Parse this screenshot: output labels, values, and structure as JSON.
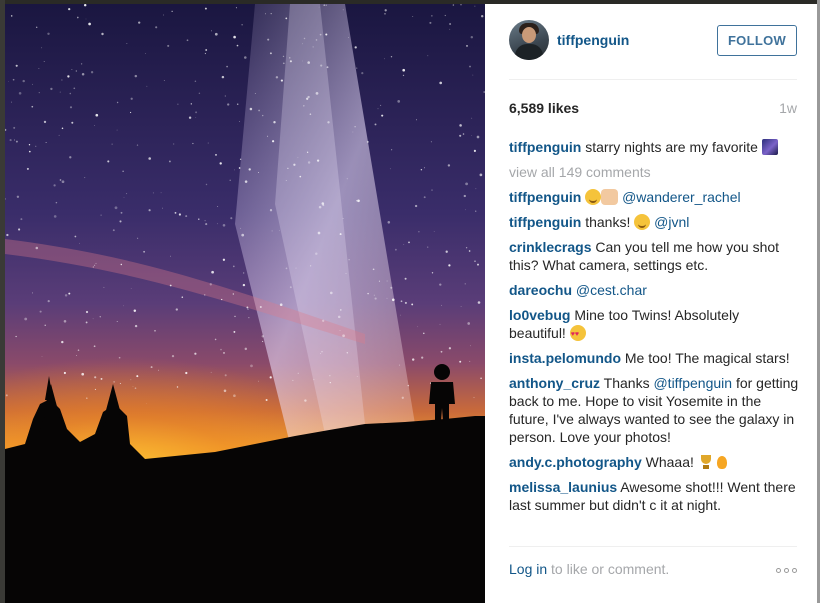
{
  "post": {
    "username": "tiffpenguin",
    "follow_label": "FOLLOW",
    "likes": "6,589 likes",
    "time_ago": "1w",
    "photo_icon": "milky-way-night-sky-photo"
  },
  "caption": {
    "user": "tiffpenguin",
    "text": "starry nights are my favorite",
    "emoji": "milky-way-emoji"
  },
  "view_all_comments": "view all 149 comments",
  "comments": [
    {
      "user": "tiffpenguin",
      "mention": "@wanderer_rachel",
      "emoji": [
        "smile-emoji",
        "raised-hands-emoji"
      ]
    },
    {
      "user": "tiffpenguin",
      "text": "thanks!",
      "mention": "@jvnl",
      "emoji": [
        "smile-emoji"
      ]
    },
    {
      "user": "crinklecrags",
      "text": "Can you tell me how you shot this? What camera, settings etc."
    },
    {
      "user": "dareochu",
      "mention": "@cest.char"
    },
    {
      "user": "lo0vebug",
      "text": "Mine too Twins! Absolutely beautiful!",
      "emoji": [
        "heart-eyes-emoji"
      ]
    },
    {
      "user": "insta.pelomundo",
      "text": "Me too! The magical stars!"
    },
    {
      "user": "anthony_cruz",
      "text_before": "Thanks",
      "mention": "@tiffpenguin",
      "text_after": "for getting back to me. Hope to visit Yosemite in the future, I've always wanted to see the galaxy in person. Love your photos!"
    },
    {
      "user": "andy.c.photography",
      "text": "Whaaa!",
      "emoji": [
        "trophy-emoji",
        "fire-emoji"
      ]
    },
    {
      "user": "melissa_launius",
      "text": "Awesome shot!!! Went there last summer but didn't c it at night."
    }
  ],
  "footer": {
    "login_link": "Log in",
    "login_rest": " to like or comment."
  },
  "colors": {
    "username_blue": "#125688",
    "follow_border": "#3f729b",
    "muted_gray": "#a5a7aa",
    "text_dark": "#262626"
  }
}
